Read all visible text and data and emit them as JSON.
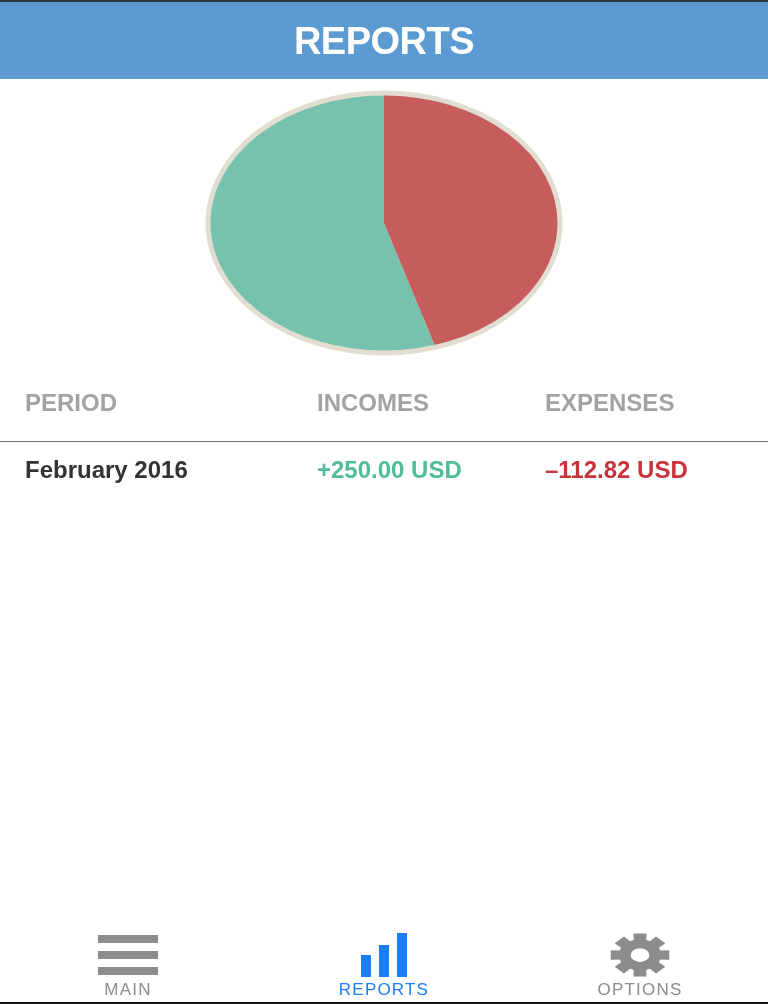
{
  "header": {
    "title": "REPORTS"
  },
  "table": {
    "columns": [
      "PERIOD",
      "INCOMES",
      "EXPENSES"
    ],
    "rows": [
      {
        "period": "February 2016",
        "incomes": "+250.00 USD",
        "expenses": "–112.82 USD"
      }
    ]
  },
  "tab_bar": {
    "tabs": [
      {
        "label": "MAIN",
        "selected": false
      },
      {
        "label": "REPORTS",
        "selected": true
      },
      {
        "label": "OPTIONS",
        "selected": false
      }
    ]
  }
}
